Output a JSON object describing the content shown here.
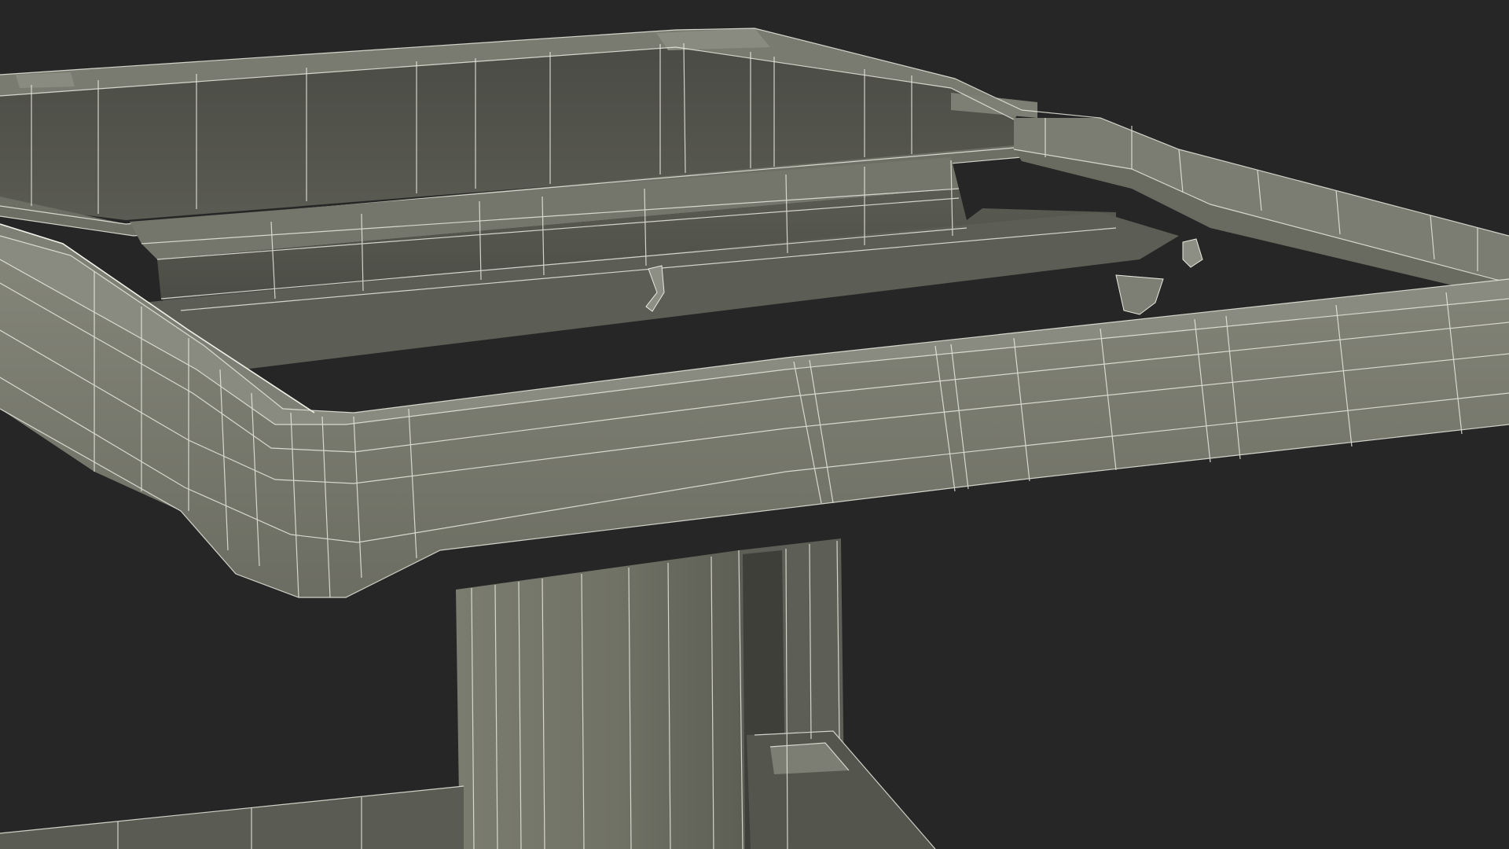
{
  "scene": {
    "subject": "wireframe-3d-model",
    "background_color": "#262626",
    "surface_light": "#7b7c70",
    "surface_mid": "#6a6b60",
    "surface_dark": "#54554c",
    "surface_shadow": "#45463f",
    "wire_color": "#e9e9e0"
  }
}
